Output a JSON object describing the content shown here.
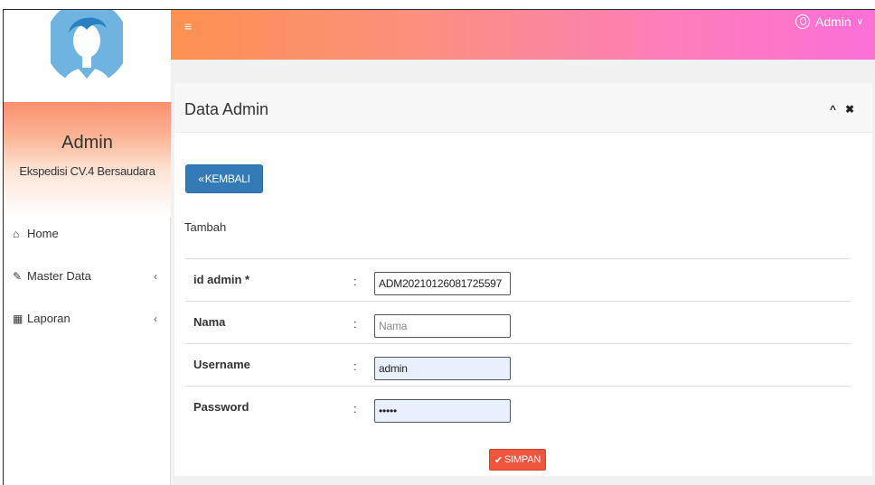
{
  "sidebar": {
    "profile_name": "Admin",
    "profile_subtitle": "Ekspedisi CV.4 Bersaudara",
    "items": [
      {
        "label": "Home",
        "icon": "home-icon"
      },
      {
        "label": "Master Data",
        "icon": "edit-icon"
      },
      {
        "label": "Laporan",
        "icon": "calendar-icon"
      }
    ]
  },
  "topbar": {
    "menu_icon": "≡",
    "user_label": "Admin"
  },
  "panel": {
    "title": "Data Admin",
    "back_label": "KEMBALI",
    "section_label": "Tambah",
    "fields": [
      {
        "label": "id admin *",
        "value": "ADM20210126081725597",
        "placeholder": ""
      },
      {
        "label": "Nama",
        "value": "",
        "placeholder": "Nama"
      },
      {
        "label": "Username",
        "value": "admin",
        "placeholder": ""
      },
      {
        "label": "Password",
        "value": "•••••",
        "placeholder": ""
      }
    ],
    "save_label": "SIMPAN"
  },
  "colors": {
    "accent_orange": "#fc9150",
    "accent_pink": "#fb6fd8",
    "primary_button": "#337ab7",
    "save_button": "#f0553d"
  }
}
